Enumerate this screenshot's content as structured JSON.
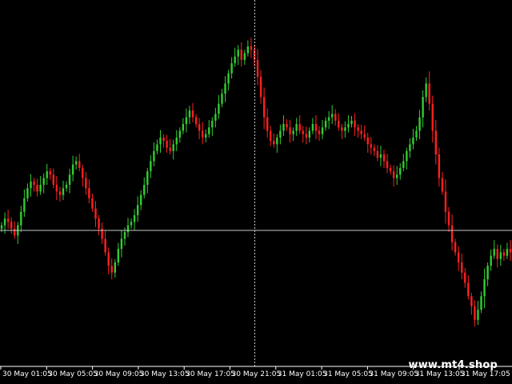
{
  "chart_data": {
    "type": "candlestick",
    "ylim": [
      0,
      100
    ],
    "time_labels": [
      "30 May 01:05",
      "30 May 05:05",
      "30 May 09:05",
      "30 May 13:05",
      "30 May 17:05",
      "30 May 21:05",
      "31 May 01:05",
      "31 May 05:05",
      "31 May 09:05",
      "31 May 13:05",
      "31 May 17:05"
    ],
    "crosshair": {
      "y_value": 36.5,
      "time_label": "30 May 21:05"
    },
    "colors": {
      "bull": "#32cd32",
      "bear": "#ff2020",
      "crosshair": "#c8c8c8",
      "background": "#000000",
      "text": "#ffffff"
    },
    "closes": [
      38,
      40,
      39,
      37,
      35,
      38,
      42,
      46,
      49,
      51,
      50,
      48,
      50,
      52,
      54,
      53,
      50,
      48,
      47,
      49,
      50,
      53,
      56,
      57,
      55,
      52,
      49,
      46,
      43,
      40,
      37,
      34,
      30,
      26,
      24,
      27,
      31,
      34,
      36,
      38,
      39,
      41,
      44,
      47,
      50,
      54,
      57,
      60,
      62,
      64,
      63,
      61,
      60,
      62,
      64,
      66,
      68,
      70,
      72,
      70,
      68,
      66,
      64,
      65,
      67,
      69,
      71,
      74,
      77,
      80,
      83,
      86,
      88,
      90,
      87,
      89,
      91,
      90,
      87,
      82,
      76,
      70,
      66,
      63,
      62,
      64,
      66,
      68,
      67,
      65,
      66,
      68,
      66,
      65,
      64,
      66,
      68,
      66,
      65,
      67,
      69,
      70,
      71,
      69,
      67,
      66,
      67,
      68,
      69,
      67,
      66,
      65,
      64,
      62,
      61,
      60,
      58,
      59,
      57,
      55,
      54,
      52,
      53,
      55,
      57,
      60,
      62,
      64,
      66,
      70,
      76,
      80,
      74,
      66,
      59,
      52,
      48,
      42,
      38,
      33,
      30,
      27,
      24,
      21,
      17,
      14,
      10,
      13,
      17,
      22,
      26,
      29,
      31,
      28,
      30,
      29,
      31,
      30
    ]
  },
  "watermark": "www.mt4.shop"
}
